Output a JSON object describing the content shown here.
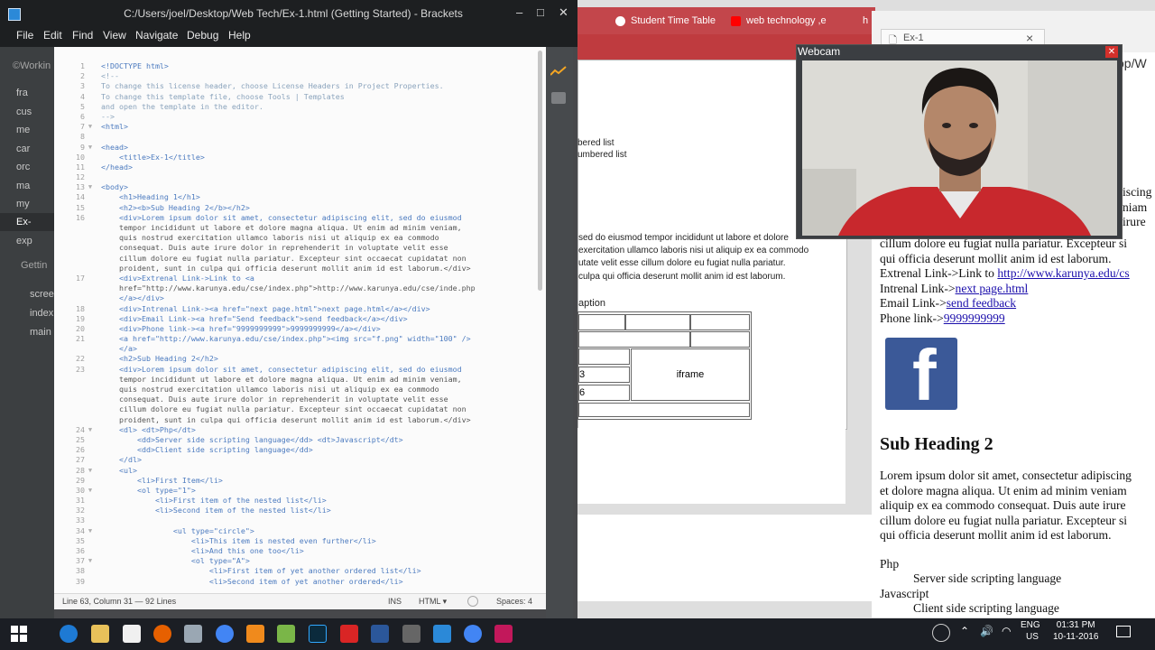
{
  "brackets": {
    "title": "C:/Users/joel/Desktop/Web Tech/Ex-1.html (Getting Started) - Brackets",
    "minimize": "–",
    "maximize": "□",
    "close": "✕",
    "menu": [
      "File",
      "Edit",
      "Find",
      "View",
      "Navigate",
      "Debug",
      "Help"
    ],
    "sidebar": {
      "working_header": "©Workin",
      "files": [
        "fra",
        "cus",
        "me",
        "car",
        "orc",
        "ma",
        "my",
        "Ex-",
        "exp"
      ],
      "getting_header": "Gettin",
      "project_files": [
        "scree",
        "index",
        "main"
      ]
    },
    "status": {
      "position": "Line 63, Column 31 — 92 Lines",
      "ins": "INS",
      "mode": "HTML ▾",
      "spaces": "Spaces: 4"
    },
    "code": [
      {
        "n": "1",
        "f": "",
        "t": "<!DOCTYPE html>"
      },
      {
        "n": "2",
        "f": "",
        "t": "<!--"
      },
      {
        "n": "3",
        "f": "",
        "t": "To change this license header, choose License Headers in Project Properties."
      },
      {
        "n": "4",
        "f": "",
        "t": "To change this template file, choose Tools | Templates"
      },
      {
        "n": "5",
        "f": "",
        "t": "and open the template in the editor."
      },
      {
        "n": "6",
        "f": "",
        "t": "-->"
      },
      {
        "n": "7",
        "f": "▼",
        "t": "<html>"
      },
      {
        "n": "8",
        "f": "",
        "t": ""
      },
      {
        "n": "9",
        "f": "▼",
        "t": "<head>"
      },
      {
        "n": "10",
        "f": "",
        "t": "    <title>Ex-1</title>"
      },
      {
        "n": "11",
        "f": "",
        "t": "</head>"
      },
      {
        "n": "12",
        "f": "",
        "t": ""
      },
      {
        "n": "13",
        "f": "▼",
        "t": "<body>"
      },
      {
        "n": "14",
        "f": "",
        "t": "    <h1>Heading 1</h1>"
      },
      {
        "n": "15",
        "f": "",
        "t": "    <h2><b>Sub Heading 2</b></h2>"
      },
      {
        "n": "16",
        "f": "",
        "t": "    <div>Lorem ipsum dolor sit amet, consectetur adipiscing elit, sed do eiusmod"
      },
      {
        "n": "",
        "f": "",
        "t": "    tempor incididunt ut labore et dolore magna aliqua. Ut enim ad minim veniam,"
      },
      {
        "n": "",
        "f": "",
        "t": "    quis nostrud exercitation ullamco laboris nisi ut aliquip ex ea commodo"
      },
      {
        "n": "",
        "f": "",
        "t": "    consequat. Duis aute irure dolor in reprehenderit in voluptate velit esse"
      },
      {
        "n": "",
        "f": "",
        "t": "    cillum dolore eu fugiat nulla pariatur. Excepteur sint occaecat cupidatat non"
      },
      {
        "n": "",
        "f": "",
        "t": "    proident, sunt in culpa qui officia deserunt mollit anim id est laborum.</div>"
      },
      {
        "n": "17",
        "f": "",
        "t": "    <div>Extrenal Link->Link to <a"
      },
      {
        "n": "",
        "f": "",
        "t": "    href=\"http://www.karunya.edu/cse/index.php\">http://www.karunya.edu/cse/inde.php"
      },
      {
        "n": "",
        "f": "",
        "t": "    </a></div>"
      },
      {
        "n": "18",
        "f": "",
        "t": "    <div>Intrenal Link-><a href=\"next page.html\">next page.html</a></div>"
      },
      {
        "n": "19",
        "f": "",
        "t": "    <div>Email Link-><a href=\"Send feedback\">send feedback</a></div>"
      },
      {
        "n": "20",
        "f": "",
        "t": "    <div>Phone link-><a href=\"9999999999\">9999999999</a></div>"
      },
      {
        "n": "21",
        "f": "",
        "t": "    <a href=\"http://www.karunya.edu/cse/index.php\"><img src=\"f.png\" width=\"100\" />"
      },
      {
        "n": "",
        "f": "",
        "t": "    </a>"
      },
      {
        "n": "22",
        "f": "",
        "t": "    <h2>Sub Heading 2</h2>"
      },
      {
        "n": "23",
        "f": "",
        "t": "    <div>Lorem ipsum dolor sit amet, consectetur adipiscing elit, sed do eiusmod"
      },
      {
        "n": "",
        "f": "",
        "t": "    tempor incididunt ut labore et dolore magna aliqua. Ut enim ad minim veniam,"
      },
      {
        "n": "",
        "f": "",
        "t": "    quis nostrud exercitation ullamco laboris nisi ut aliquip ex ea commodo"
      },
      {
        "n": "",
        "f": "",
        "t": "    consequat. Duis aute irure dolor in reprehenderit in voluptate velit esse"
      },
      {
        "n": "",
        "f": "",
        "t": "    cillum dolore eu fugiat nulla pariatur. Excepteur sint occaecat cupidatat non"
      },
      {
        "n": "",
        "f": "",
        "t": "    proident, sunt in culpa qui officia deserunt mollit anim id est laborum.</div>"
      },
      {
        "n": "24",
        "f": "▼",
        "t": "    <dl> <dt>Php</dt>"
      },
      {
        "n": "25",
        "f": "",
        "t": "        <dd>Server side scripting language</dd> <dt>Javascript</dt>"
      },
      {
        "n": "26",
        "f": "",
        "t": "        <dd>Client side scripting language</dd>"
      },
      {
        "n": "27",
        "f": "",
        "t": "    </dl>"
      },
      {
        "n": "28",
        "f": "▼",
        "t": "    <ul>"
      },
      {
        "n": "29",
        "f": "",
        "t": "        <li>First Item</li>"
      },
      {
        "n": "30",
        "f": "▼",
        "t": "        <ol type=\"1\">"
      },
      {
        "n": "31",
        "f": "",
        "t": "            <li>First item of the nested list</li>"
      },
      {
        "n": "32",
        "f": "",
        "t": "            <li>Second item of the nested list</li>"
      },
      {
        "n": "33",
        "f": "",
        "t": ""
      },
      {
        "n": "34",
        "f": "▼",
        "t": "                <ul type=\"circle\">"
      },
      {
        "n": "35",
        "f": "",
        "t": "                    <li>This item is nested even further</li>"
      },
      {
        "n": "36",
        "f": "",
        "t": "                    <li>And this one too</li>"
      },
      {
        "n": "37",
        "f": "▼",
        "t": "                    <ol type=\"A\">"
      },
      {
        "n": "38",
        "f": "",
        "t": "                        <li>First item of yet another ordered list</li>"
      },
      {
        "n": "39",
        "f": "",
        "t": "                        <li>Second item of yet another ordered</li>"
      }
    ]
  },
  "browser_left": {
    "tabs": [
      "Student Time Table",
      "web technology ,e",
      "h"
    ],
    "lines": [
      "bered list",
      "umbered list",
      "sed do eiusmod tempor incididunt ut labore et dolore",
      "exercitation ullamco laboris nisi ut aliquip ex ea commodo",
      "utate velit esse cillum dolore eu fugiat nulla pariatur.",
      "culpa qui officia deserunt mollit anim id est laborum."
    ],
    "caption": "aption",
    "cells": [
      "3",
      "6",
      "iframe"
    ]
  },
  "browser_right": {
    "tab_title": "Ex-1",
    "tab_close": "×",
    "url_fragment": "op/W",
    "frag_lines": [
      "iscing",
      "niam",
      "irure"
    ],
    "p1_line1": "cillum dolore eu fugiat nulla pariatur. Excepteur si",
    "p1_line2": "qui officia deserunt mollit anim id est laborum.",
    "ext_label": "Extrenal Link->Link to ",
    "ext_link": "http://www.karunya.edu/cs",
    "int_label": "Intrenal Link->",
    "int_link": "next page.html",
    "email_label": "Email Link->",
    "email_link": "send feedback",
    "phone_label": "Phone link->",
    "phone_link": "9999999999",
    "fb_letter": "f",
    "subheading": "Sub Heading 2",
    "lorem": [
      "Lorem ipsum dolor sit amet, consectetur adipiscing",
      "et dolore magna aliqua. Ut enim ad minim veniam",
      "aliquip ex ea commodo consequat. Duis aute irure",
      "cillum dolore eu fugiat nulla pariatur. Excepteur si",
      "qui officia deserunt mollit anim id est laborum."
    ],
    "dt1": "Php",
    "dd1": "Server side scripting language",
    "dt2": "Javascript",
    "dd2": "Client side scripting language"
  },
  "webcam": {
    "title": "Webcam",
    "close": "✕"
  },
  "taskbar": {
    "lang_top": "ENG",
    "lang_bottom": "US",
    "time": "01:31 PM",
    "date": "10-11-2016"
  },
  "colors": {
    "accent_red": "#c3464b",
    "brackets_dark": "#1d1f21",
    "link": "#1a0dab"
  }
}
